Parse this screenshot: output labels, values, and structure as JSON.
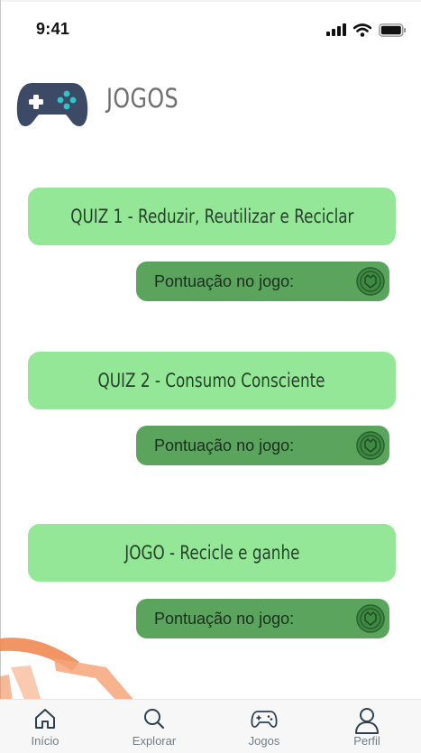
{
  "status_bar": {
    "time": "9:41"
  },
  "header": {
    "title": "JOGOS",
    "icon": "gamepad-icon"
  },
  "games": [
    {
      "label": "QUIZ 1 - Reduzir, Reutilizar e Reciclar",
      "score_label": "Pontuação no jogo:"
    },
    {
      "label": "QUIZ 2 - Consumo Consciente",
      "score_label": "Pontuação no jogo:"
    },
    {
      "label": "JOGO - Recicle e ganhe",
      "score_label": "Pontuação no jogo:"
    }
  ],
  "tab_bar": {
    "items": [
      {
        "label": "Início",
        "icon": "home-icon"
      },
      {
        "label": "Explorar",
        "icon": "search-icon"
      },
      {
        "label": "Jogos",
        "icon": "gamepad-icon"
      },
      {
        "label": "Perfil",
        "icon": "user-icon"
      }
    ]
  },
  "colors": {
    "game_button": "#93e796",
    "score_pill": "#5aa45d",
    "title_text": "#6e6e6e",
    "logo": "#3d4a66",
    "logo_buttons": "#2ec4c9",
    "tab_icon": "#2f4050"
  }
}
